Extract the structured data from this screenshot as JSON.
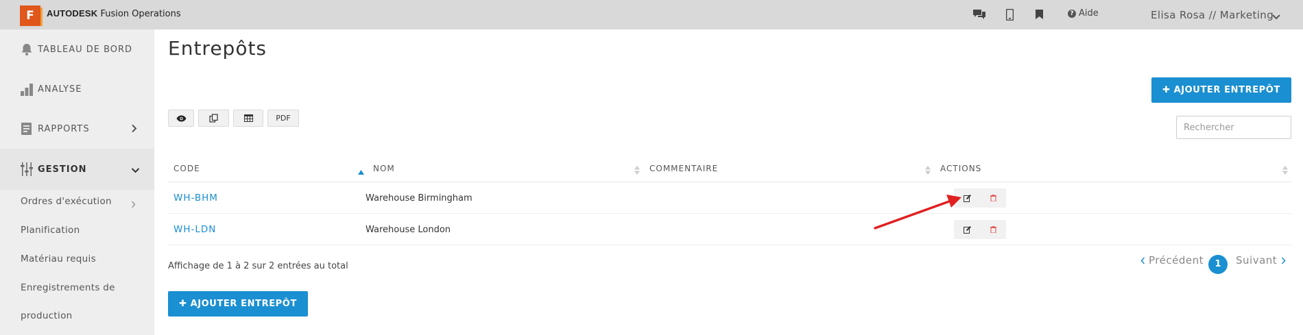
{
  "app": {
    "brand_bold": "AUTODESK",
    "brand_rest": " Fusion Operations",
    "logo_letter": "F"
  },
  "topbar": {
    "help_label": "Aide",
    "user_label": "Elisa Rosa // Marketing",
    "icons": [
      "chat-icon",
      "mobile-icon",
      "bookmark-icon",
      "help-icon",
      "chevron-down-icon"
    ]
  },
  "sidebar": {
    "items": [
      {
        "label": "TABLEAU DE BORD",
        "icon": "bell-icon"
      },
      {
        "label": "ANALYSE",
        "icon": "bar-chart-icon"
      },
      {
        "label": "RAPPORTS",
        "icon": "report-icon"
      },
      {
        "label": "GESTION",
        "icon": "sliders-icon"
      }
    ],
    "sub_items": [
      {
        "label": "Ordres d'exécution"
      },
      {
        "label": "Planification"
      },
      {
        "label": "Matériau requis"
      },
      {
        "label": "Enregistrements de"
      },
      {
        "label": "production"
      }
    ]
  },
  "page": {
    "title": "Entrepôts",
    "add_button_label": "AJOUTER ENTREPÔT",
    "search_placeholder": "Rechercher",
    "pdf_label": "PDF"
  },
  "table": {
    "columns": [
      "CODE",
      "NOM",
      "COMMENTAIRE",
      "ACTIONS"
    ],
    "rows": [
      {
        "code": "WH-BHM",
        "name": "Warehouse Birmingham",
        "comment": ""
      },
      {
        "code": "WH-LDN",
        "name": "Warehouse London",
        "comment": ""
      }
    ]
  },
  "footer": {
    "info": "Affichage de 1 à 2 sur 2 entrées au total",
    "prev_label": "Précédent",
    "next_label": "Suivant",
    "current_page": "1"
  },
  "colors": {
    "accent": "#1a8fd1",
    "topbar": "#d9d9d9",
    "sidebar": "#eeeeee",
    "delete": "#e05a5a",
    "annotation_arrow": "#e02020"
  }
}
